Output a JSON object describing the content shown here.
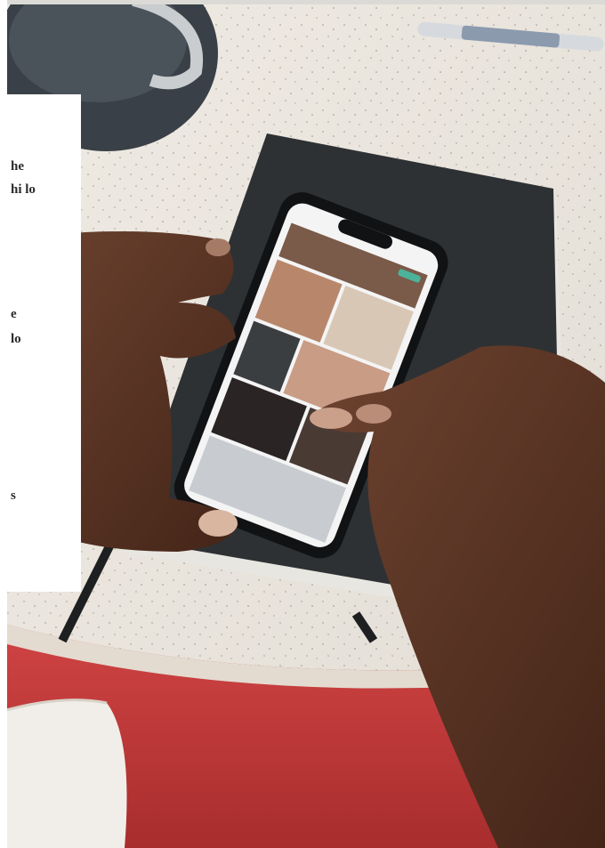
{
  "photo": {
    "scene": "hands-scrolling-photo-gallery-on-phone",
    "colors": {
      "table": "#e9e4dc",
      "notebook": "#2c2e30",
      "skin": "#5a3524",
      "red_cloth": "#c23a3a",
      "cup": "#3c4248"
    }
  },
  "card": {
    "lines": [
      "he",
      "hi lo",
      "e",
      "lo",
      "s"
    ]
  }
}
